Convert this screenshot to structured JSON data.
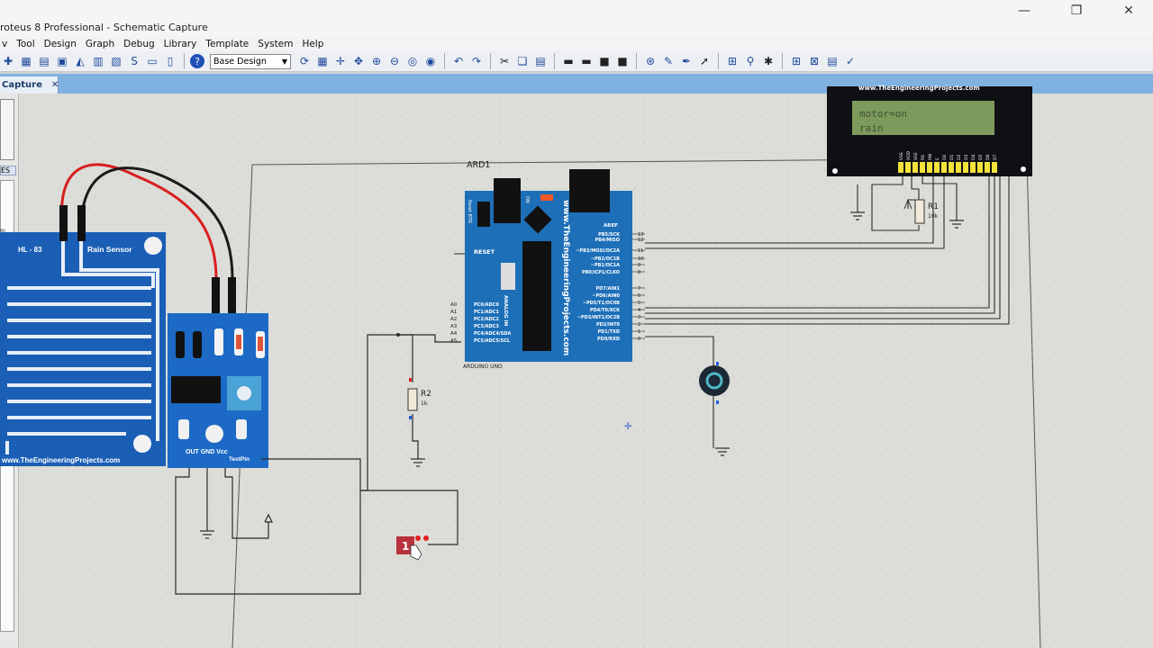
{
  "window": {
    "title": "roteus 8 Professional - Schematic Capture",
    "controls": [
      "—",
      "❐",
      "✕"
    ]
  },
  "menu": [
    "v",
    "Tool",
    "Design",
    "Graph",
    "Debug",
    "Library",
    "Template",
    "System",
    "Help"
  ],
  "toolbar": {
    "design_select_value": "Base Design"
  },
  "tab": {
    "label": "Capture",
    "close": "✕"
  },
  "sidebar": {
    "label_es": "ES",
    "label_bl": "BL"
  },
  "schematic": {
    "arduino": {
      "ref": "ARD1",
      "part": "ARDUINO UNO",
      "website": "www.TheEngineeringProjects.com",
      "reset_label": "RESET",
      "reset_btn": "Reset BTN",
      "on_label": "ON",
      "analog_in": "ANALOG IN",
      "aref": "AREF",
      "digital_pins": [
        "PB5/SCK",
        "PB4/MISO",
        "~PB3/MOSI/OC2A",
        "~PB2/OC1B",
        "~PB1/OC1A",
        "PB0/ICP1/CLKO",
        "PD7/AIN1",
        "~PD6/AIN0",
        "~PD5/T1/OC0B",
        "PD4/T0/XCK",
        "~PD3/INT1/OC2B",
        "PD2/INT0",
        "PD1/TXD",
        "PD0/RXD"
      ],
      "digital_numbers": [
        "13",
        "12",
        "11",
        "10",
        "9",
        "8",
        "7",
        "6",
        "5",
        "4",
        "3",
        "2",
        "1",
        "0"
      ],
      "analog_pins": [
        "PC0/ADC0",
        "PC1/ADC1",
        "PC2/ADC2",
        "PC3/ADC3",
        "PC4/ADC4/SDA",
        "PC5/ADC5/SCL"
      ],
      "analog_numbers": [
        "A0",
        "A1",
        "A2",
        "A3",
        "A4",
        "A5"
      ]
    },
    "rain_sensor": {
      "model": "HL - 83",
      "name": "Rain Sensor",
      "website": "www.TheEngineeringProjects.com",
      "pins": "OUT GND Vcc",
      "testpin": "TestPin"
    },
    "lcd": {
      "website": "www.TheEngineeringProjects.com",
      "line1": "motor=on",
      "line2": "rain",
      "pins": [
        "VSS",
        "VDD",
        "VEE",
        "RS",
        "RW",
        "E",
        "D0",
        "D1",
        "D2",
        "D3",
        "D4",
        "D5",
        "D6",
        "D7"
      ]
    },
    "r1": {
      "ref": "R1",
      "value": "10k"
    },
    "r2": {
      "ref": "R2",
      "value": "1k"
    },
    "logic_state": "1",
    "colors": {
      "board_blue": "#1d6fb8",
      "sensor_blue": "#1a5eb5",
      "module_blue": "#1c6ac6",
      "lcd_green": "#7d9a5c",
      "wire": "#2a2a2a",
      "red_wire": "#d81e1e"
    }
  }
}
